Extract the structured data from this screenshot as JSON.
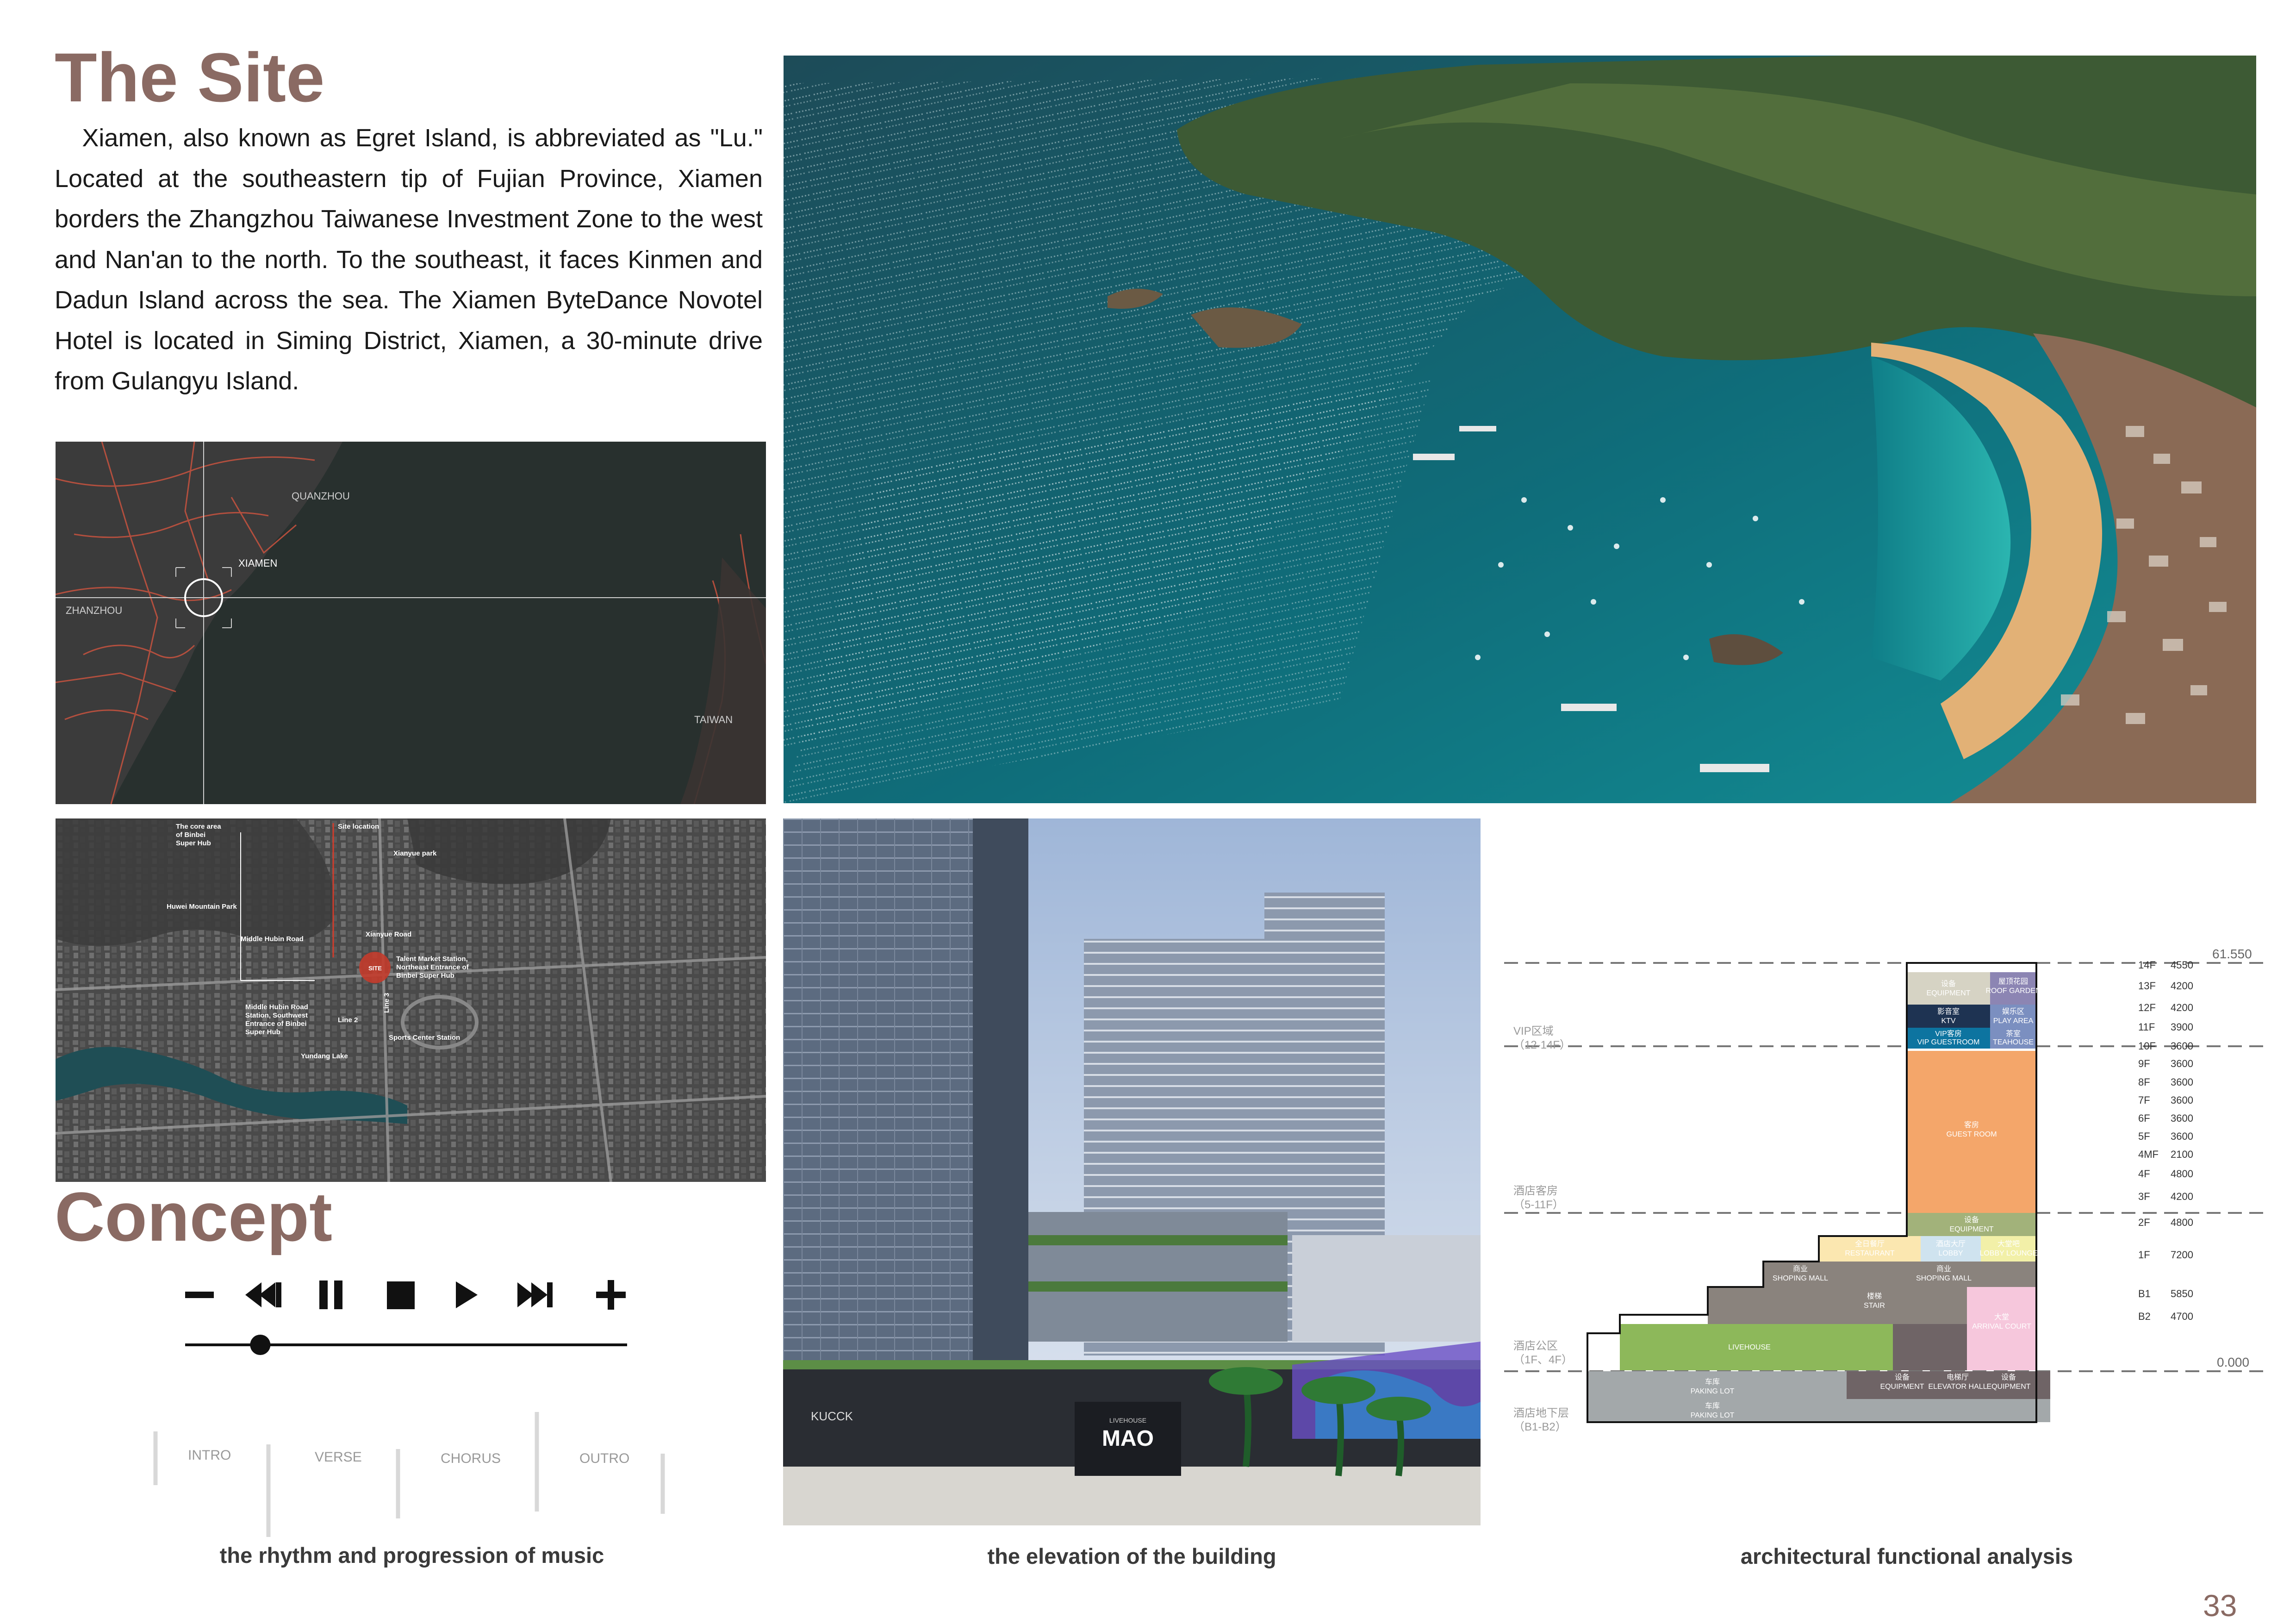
{
  "page": {
    "title": "The Site",
    "intro": "Xiamen, also known as Egret Island, is abbreviated as \"Lu.\" Located at the southeastern tip of Fujian Province, Xiamen borders the Zhangzhou Taiwanese Investment Zone to the west and Nan'an to the north. To the southeast, it faces Kinmen and Dadun Island across the sea. The Xiamen ByteDance Novotel Hotel is located in Siming District, Xiamen, a 30-minute drive from Gulangyu Island.",
    "concept_title": "Concept",
    "page_number": "33"
  },
  "region_map": {
    "labels": {
      "quanzhou": "QUANZHOU",
      "xiamen": "XIAMEN",
      "zhanzhou": "ZHANZHOU",
      "taiwan": "TAIWAN"
    }
  },
  "site_map": {
    "labels": {
      "core_area_1": "The core area",
      "core_area_2": "of Binbei",
      "core_area_3": "Super Hub",
      "site_location": "Site location",
      "xianyue_park": "Xianyue park",
      "huwei_park": "Huwei Mountain Park",
      "middle_hubin_road": "Middle Hubin Road",
      "xianyue_road": "Xianyue Road",
      "site": "SITE",
      "talent_1": "Talent Market Station,",
      "talent_2": "Northeast Entrance of",
      "talent_3": "Binbei Super Hub",
      "mh_station_1": "Middle Hubin Road",
      "mh_station_2": "Station, Southwest",
      "mh_station_3": "Entrance of Binbei",
      "mh_station_4": "Super Hub",
      "line2": "Line 2",
      "line3": "Line 3",
      "sports_center": "Sports Center Station",
      "yundang_lake": "Yundang Lake"
    }
  },
  "player": {
    "controls": [
      {
        "name": "volume-down-icon",
        "glyph": "minus"
      },
      {
        "name": "rewind-icon",
        "glyph": "rewind"
      },
      {
        "name": "pause-icon",
        "glyph": "pause"
      },
      {
        "name": "stop-icon",
        "glyph": "stop"
      },
      {
        "name": "play-icon",
        "glyph": "play"
      },
      {
        "name": "fast-forward-icon",
        "glyph": "fastforward"
      },
      {
        "name": "volume-up-icon",
        "glyph": "plus"
      }
    ],
    "progress": 0.17
  },
  "rhythm": {
    "sections": [
      "INTRO",
      "VERSE",
      "CHORUS",
      "OUTRO"
    ]
  },
  "render": {
    "store_sign": "KUCCK",
    "venue_sign": "MAO",
    "venue_sub": "LIVEHOUSE"
  },
  "section_diagram": {
    "top_elevation": "61.550",
    "ground_elevation": "0.000",
    "zones": [
      {
        "zh": "VIP区域",
        "range": "（12-14F）"
      },
      {
        "zh": "酒店客房",
        "range": "（5-11F）"
      },
      {
        "zh": "酒店公区",
        "range": "（1F、4F）"
      },
      {
        "zh": "酒店地下层",
        "range": "（B1-B2）"
      }
    ],
    "floors": [
      {
        "floor": "14F",
        "height": "4550"
      },
      {
        "floor": "13F",
        "height": "4200"
      },
      {
        "floor": "12F",
        "height": "4200"
      },
      {
        "floor": "11F",
        "height": "3900"
      },
      {
        "floor": "10F",
        "height": "3600"
      },
      {
        "floor": "9F",
        "height": "3600"
      },
      {
        "floor": "8F",
        "height": "3600"
      },
      {
        "floor": "7F",
        "height": "3600"
      },
      {
        "floor": "6F",
        "height": "3600"
      },
      {
        "floor": "5F",
        "height": "3600"
      },
      {
        "floor": "4MF",
        "height": "2100"
      },
      {
        "floor": "4F",
        "height": "4800"
      },
      {
        "floor": "3F",
        "height": "4200"
      },
      {
        "floor": "2F",
        "height": "4800"
      },
      {
        "floor": "1F",
        "height": "7200"
      },
      {
        "floor": "B1",
        "height": "5850"
      },
      {
        "floor": "B2",
        "height": "4700"
      }
    ],
    "rooms": {
      "equipment_zh": "设备",
      "equipment": "EQUIPMENT",
      "roof_garden_zh": "屋顶花园",
      "roof_garden": "ROOF GARDEN",
      "ktv_zh": "影音室",
      "ktv": "KTV",
      "play_zh": "娱乐区",
      "play": "PLAY AREA",
      "vip_zh": "VIP客房",
      "vip": "VIP GUESTROOM",
      "tea_zh": "茶室",
      "tea": "TEAHOUSE",
      "guest_zh": "客房",
      "guest": "GUEST ROOM",
      "restaurant_zh": "全日餐厅",
      "restaurant": "RESTAURANT",
      "lobby_zh": "酒店大厅",
      "lobby": "LOBBY",
      "lounge_zh": "大堂吧",
      "lounge": "LOBBY LOUNGE",
      "mall_zh": "商业",
      "mall": "SHOPING MALL",
      "stair_zh": "楼梯",
      "stair": "STAIR",
      "arrival_zh": "大堂",
      "arrival": "ARRIVAL COURT",
      "livehouse": "LIVEHOUSE",
      "parking_zh": "车库",
      "parking": "PAKING LOT",
      "elevator_zh": "电梯厅",
      "elevator": "ELEVATOR HALL"
    }
  },
  "captions": {
    "music": "the rhythm and progression of music",
    "elevation": "the elevation of the building",
    "analysis": "architectural functional analysis"
  },
  "colors": {
    "title": "#8a6a63",
    "guest_room": "#f4a66a",
    "livehouse": "#8db85a",
    "parking": "#a3a8aa",
    "vip": "#0d74a0",
    "arrival": "#f6c7dc",
    "lobby": "#fbe7b0"
  }
}
